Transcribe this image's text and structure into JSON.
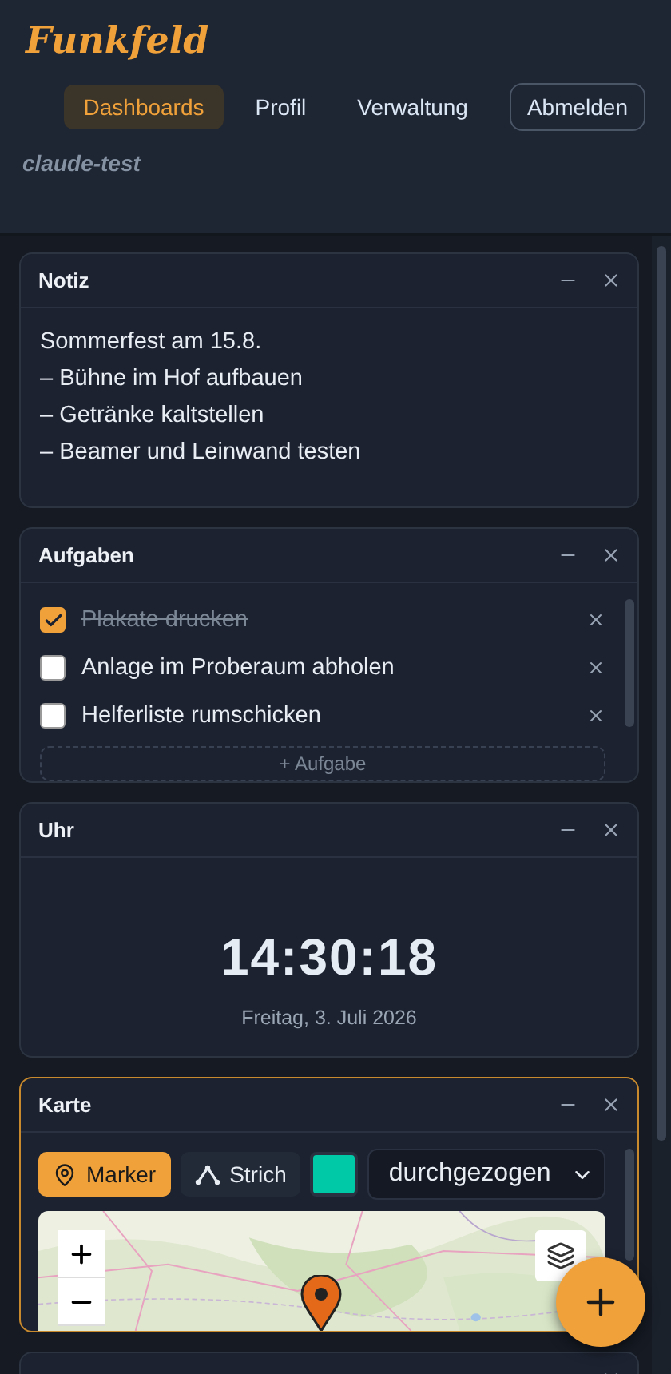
{
  "app": {
    "logo": "Funkfeld"
  },
  "nav": [
    {
      "label": "Dashboards",
      "selected": true
    },
    {
      "label": "Profil",
      "selected": false
    },
    {
      "label": "Verwaltung",
      "selected": false
    }
  ],
  "logout": "Abmelden",
  "dashboard": {
    "name": "claude-test"
  },
  "widgets": [
    {
      "kind": "note",
      "title": "Notiz",
      "focused": false,
      "lines": [
        "Sommerfest am 15.8.",
        "– Bühne im Hof aufbauen",
        "– Getränke kaltstellen",
        "– Beamer und Leinwand testen"
      ]
    },
    {
      "kind": "todo",
      "title": "Aufgaben",
      "focused": false,
      "items": [
        {
          "text": "Plakate drucken",
          "checked": true
        },
        {
          "text": "Anlage im Proberaum abholen",
          "checked": false
        },
        {
          "text": "Helferliste rumschicken",
          "checked": false
        }
      ],
      "add_label": "+ Aufgabe"
    },
    {
      "kind": "clock",
      "title": "Uhr",
      "focused": false,
      "time": "14:30:18",
      "date": "Freitag, 3. Juli 2026"
    },
    {
      "kind": "map",
      "title": "Karte",
      "focused": true,
      "tools": [
        {
          "kind": "marker",
          "label": "Marker",
          "selected": true
        },
        {
          "kind": "line",
          "label": "Strich",
          "selected": false
        }
      ],
      "color": "#00c9a7",
      "line_style": "durchgezogen",
      "map": {
        "kind": "picture"
      }
    },
    {
      "kind": "partial",
      "focused": false
    }
  ]
}
